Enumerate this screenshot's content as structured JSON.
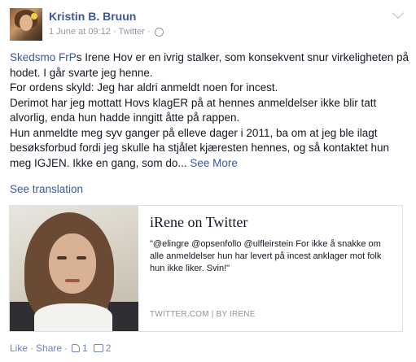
{
  "post": {
    "author": "Kristin B. Bruun",
    "date": "1 June at 09:12",
    "via": "Twitter",
    "body": {
      "mention": "Skedsmo FrP",
      "line1_rest": "s Irene Hov er en ivrig stalker, som konsekvent snur virkeligheten på hodet. I går svarte jeg henne.",
      "line2": "For ordens skyld: Jeg har aldri anmeldt noen for incest.",
      "line3": "Derimot har jeg mottatt Hovs klagER på at hennes anmeldelser ikke blir tatt alvorlig, enda hun hadde inngitt åtte på rappen.",
      "line4": "Hun anmeldte meg syv ganger på elleve dager i 2011, ba om at jeg ble ilagt besøksforbud fordi jeg skulle ha stjålet kjæresten hennes, og så kontaktet hun meg IGJEN. Ikke en gang, som do...",
      "see_more": "See More"
    },
    "see_translation": "See translation",
    "card": {
      "title": "iRene on Twitter",
      "description": "\"@elingre @opsenfollo @ulfleirstein For ikke å snakke om alle anmeldelser hun har levert på incest anklager mot folk hun ikke liker. Svin!\"",
      "source": "TWITTER.COM  |  BY IRENE"
    },
    "actions": {
      "like": "Like",
      "share": "Share",
      "separator": "·",
      "like_count": "1",
      "comment_count": "2"
    }
  }
}
